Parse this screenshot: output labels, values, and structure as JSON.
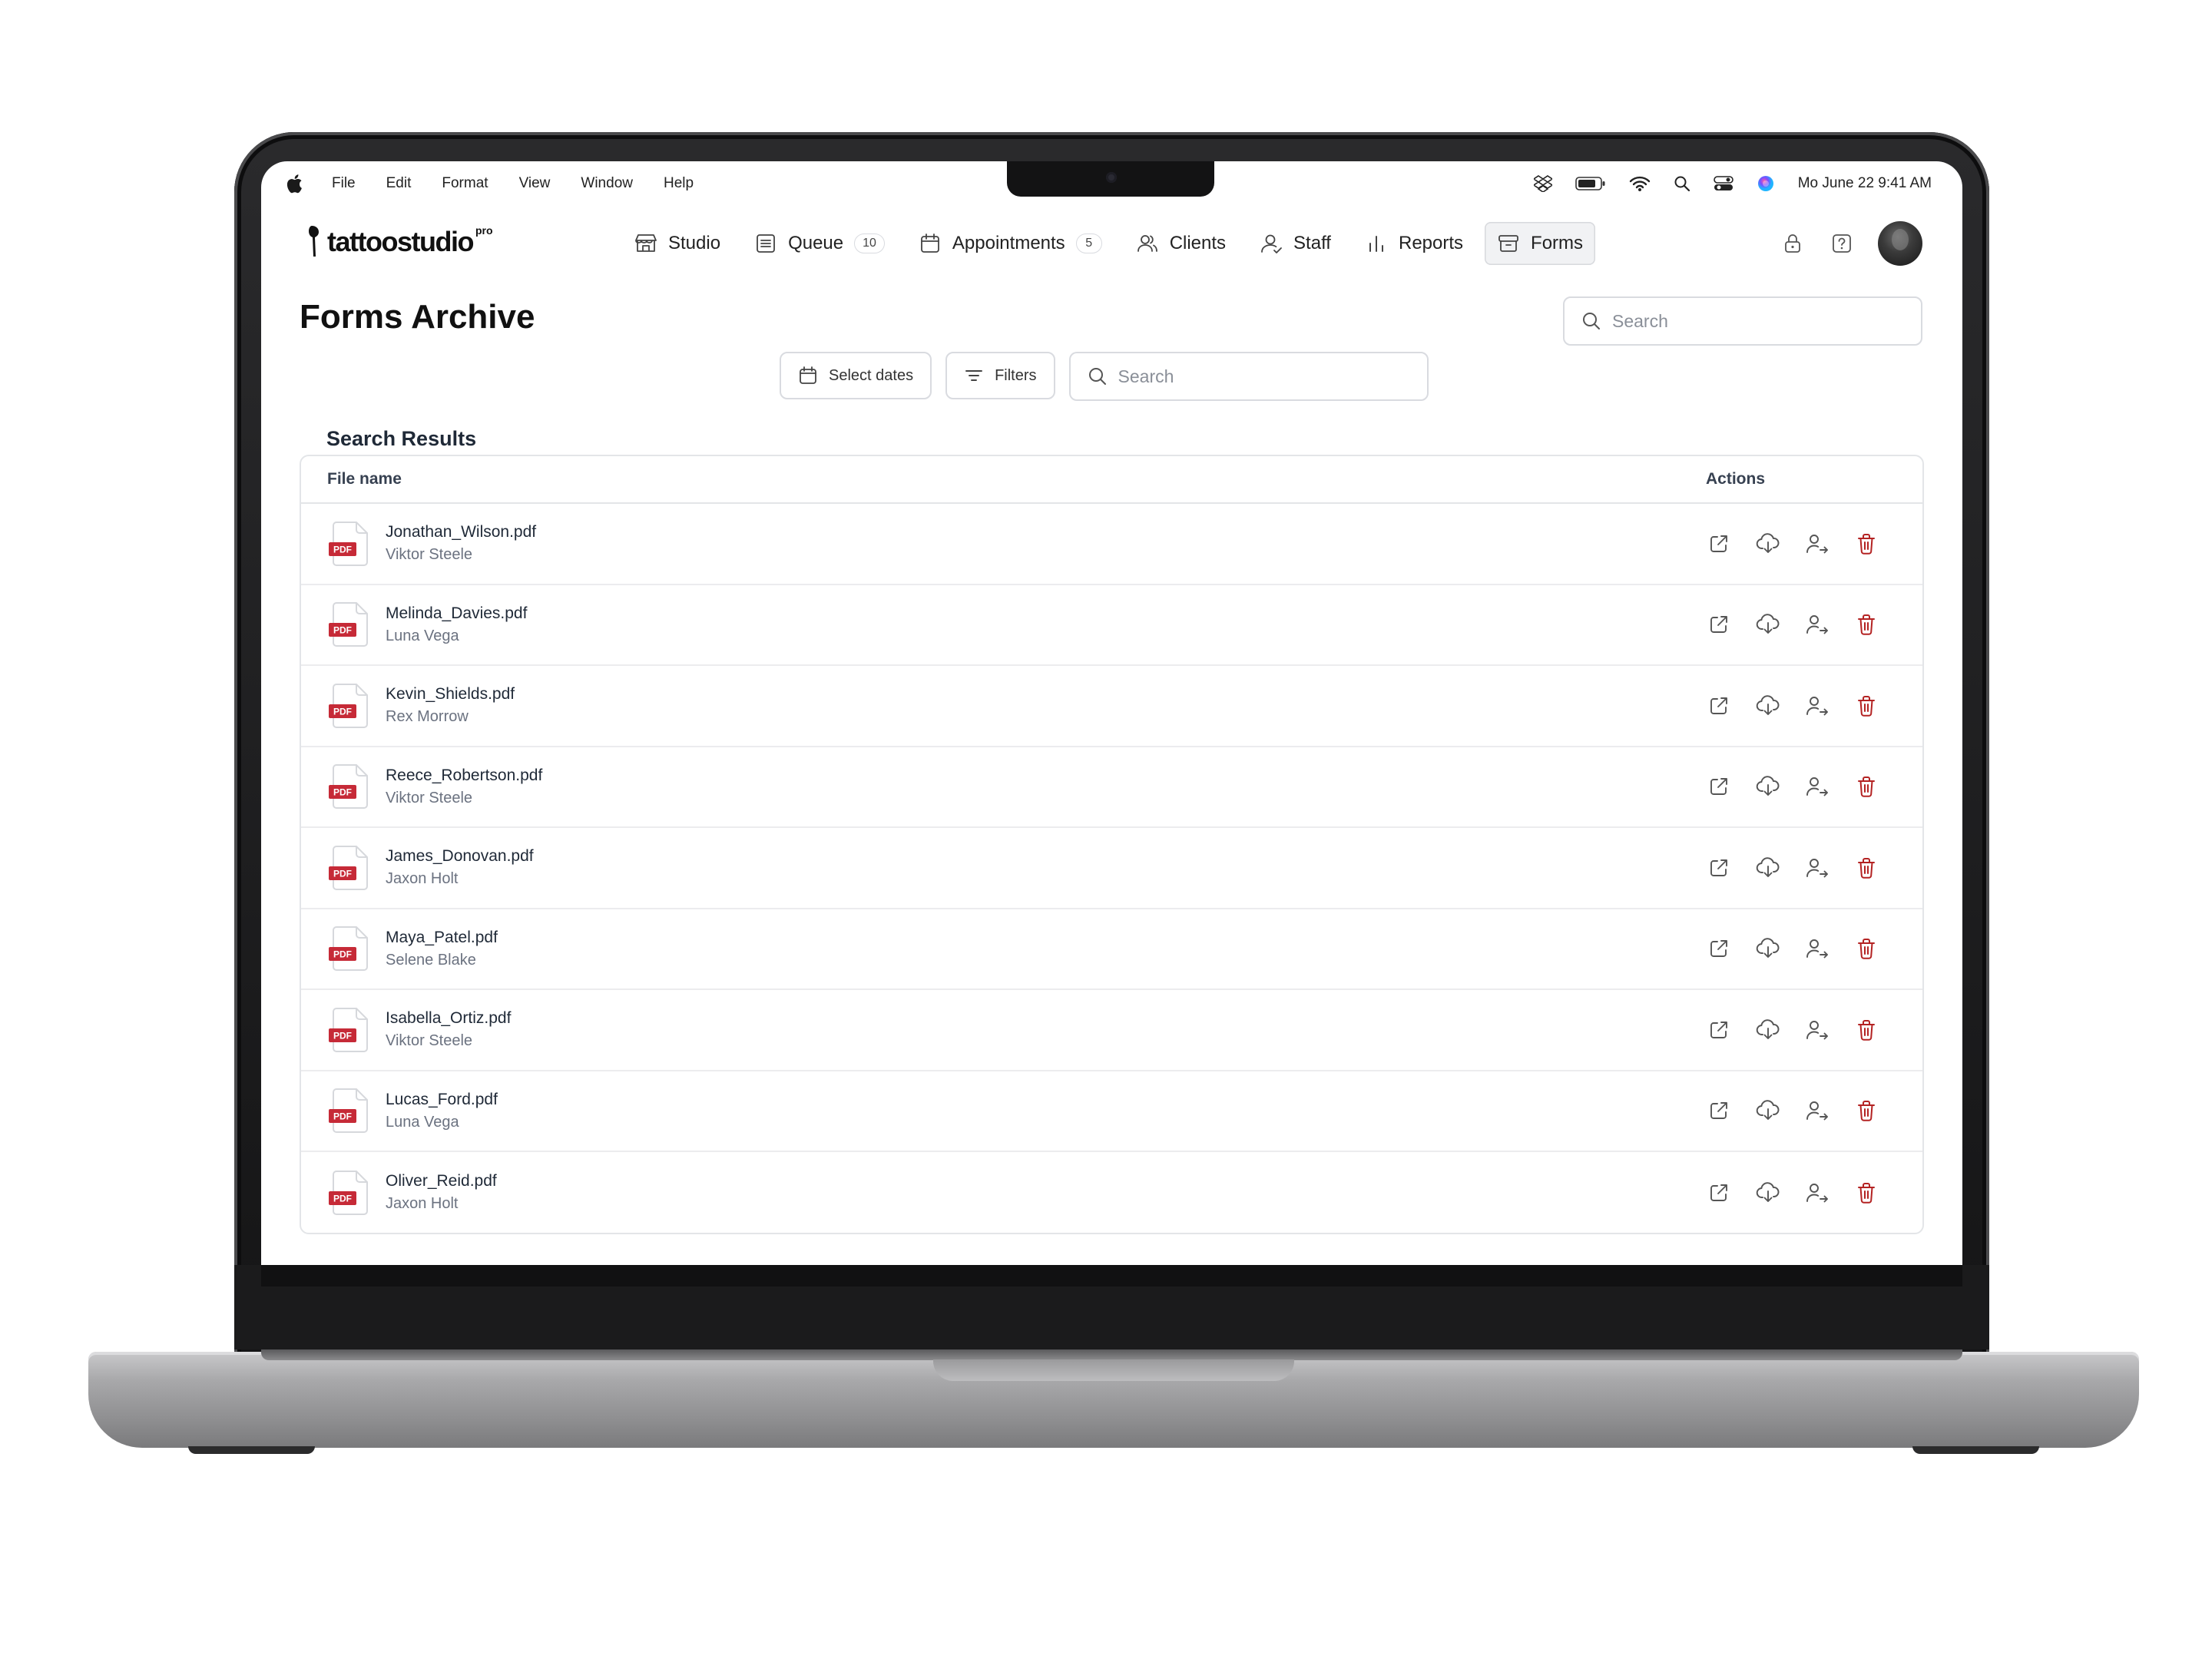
{
  "menubar": {
    "menus": [
      "File",
      "Edit",
      "Format",
      "View",
      "Window",
      "Help"
    ],
    "clock": "Mo June 22  9:41 AM"
  },
  "app": {
    "logo_text": "tattoostudio",
    "logo_suffix": "pro"
  },
  "nav": {
    "items": [
      {
        "label": "Studio",
        "icon": "studio-icon"
      },
      {
        "label": "Queue",
        "icon": "queue-icon",
        "badge": "10"
      },
      {
        "label": "Appointments",
        "icon": "calendar-icon",
        "badge": "5"
      },
      {
        "label": "Clients",
        "icon": "clients-icon"
      },
      {
        "label": "Staff",
        "icon": "staff-icon"
      },
      {
        "label": "Reports",
        "icon": "reports-icon"
      },
      {
        "label": "Forms",
        "icon": "forms-icon",
        "active": true
      }
    ]
  },
  "page": {
    "title": "Forms Archive",
    "top_search_placeholder": "Search",
    "select_dates_label": "Select dates",
    "filters_label": "Filters",
    "search_placeholder": "Search",
    "results_title": "Search Results"
  },
  "table": {
    "columns": [
      "File name",
      "Actions"
    ],
    "pdf_label": "PDF",
    "rows": [
      {
        "file": "Jonathan_Wilson.pdf",
        "artist": "Viktor Steele"
      },
      {
        "file": "Melinda_Davies.pdf",
        "artist": "Luna Vega"
      },
      {
        "file": "Kevin_Shields.pdf",
        "artist": "Rex Morrow"
      },
      {
        "file": "Reece_Robertson.pdf",
        "artist": "Viktor Steele"
      },
      {
        "file": "James_Donovan.pdf",
        "artist": "Jaxon Holt"
      },
      {
        "file": "Maya_Patel.pdf",
        "artist": "Selene Blake"
      },
      {
        "file": "Isabella_Ortiz.pdf",
        "artist": "Viktor Steele"
      },
      {
        "file": "Lucas_Ford.pdf",
        "artist": "Luna Vega"
      },
      {
        "file": "Oliver_Reid.pdf",
        "artist": "Jaxon Holt"
      }
    ]
  },
  "colors": {
    "pdf_red": "#c62a37",
    "delete_red": "#b42323",
    "border": "#d9dbe0"
  }
}
